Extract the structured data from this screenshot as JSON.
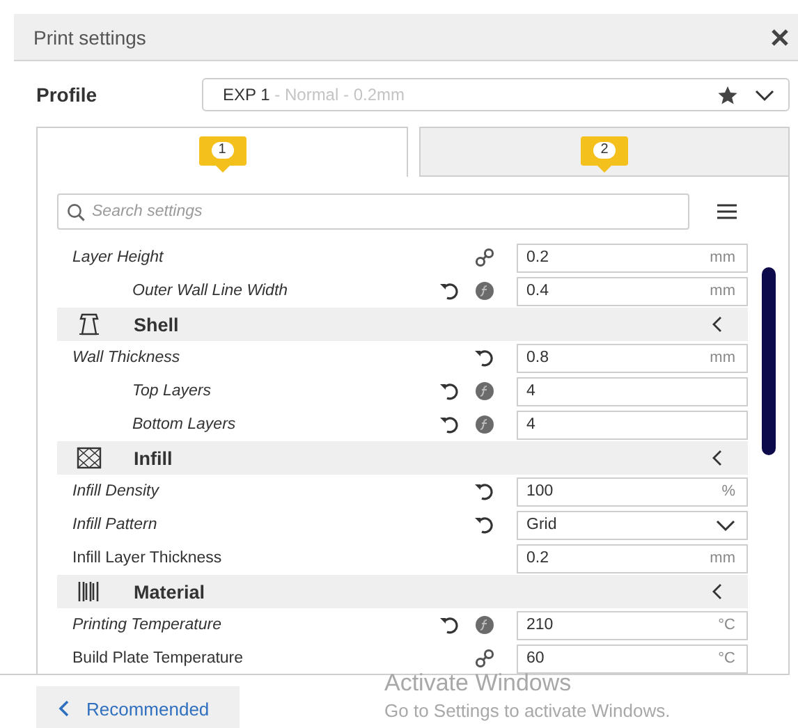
{
  "window": {
    "title": "Print settings"
  },
  "profile": {
    "label": "Profile",
    "name": "EXP 1",
    "detail": " - Normal - 0.2mm"
  },
  "tabs": [
    {
      "badge": "1",
      "selected": true
    },
    {
      "badge": "2",
      "selected": false
    }
  ],
  "search": {
    "placeholder": "Search settings"
  },
  "rows": [
    {
      "kind": "setting",
      "label": "Layer Height",
      "modified": true,
      "linked": true,
      "value": "0.2",
      "unit": "mm",
      "children": [
        {
          "kind": "setting",
          "label": "Outer Wall Line Width",
          "modified": true,
          "reset": true,
          "formula": true,
          "value": "0.4",
          "unit": "mm"
        }
      ]
    },
    {
      "kind": "category",
      "label": "Shell"
    },
    {
      "kind": "setting",
      "label": "Wall Thickness",
      "modified": true,
      "reset": true,
      "value": "0.8",
      "unit": "mm",
      "children": [
        {
          "kind": "setting",
          "label": "Top Layers",
          "modified": true,
          "reset": true,
          "formula": true,
          "value": "4"
        },
        {
          "kind": "setting",
          "label": "Bottom Layers",
          "modified": true,
          "reset": true,
          "formula": true,
          "value": "4"
        }
      ]
    },
    {
      "kind": "category",
      "label": "Infill"
    },
    {
      "kind": "setting",
      "label": "Infill Density",
      "modified": true,
      "reset": true,
      "value": "100",
      "unit": "%"
    },
    {
      "kind": "dropdown",
      "label": "Infill Pattern",
      "modified": true,
      "reset": true,
      "value": "Grid"
    },
    {
      "kind": "setting",
      "label": "Infill Layer Thickness",
      "modified": false,
      "value": "0.2",
      "unit": "mm"
    },
    {
      "kind": "category",
      "label": "Material"
    },
    {
      "kind": "setting",
      "label": "Printing Temperature",
      "modified": true,
      "reset": true,
      "formula": true,
      "value": "210",
      "unit": "°C"
    },
    {
      "kind": "setting",
      "label": "Build Plate Temperature",
      "modified": false,
      "linked": true,
      "value": "60",
      "unit": "°C"
    }
  ],
  "footer": {
    "button": "Recommended"
  },
  "os_notice": {
    "title": "Activate Windows",
    "text": "Go to Settings to activate Windows."
  }
}
